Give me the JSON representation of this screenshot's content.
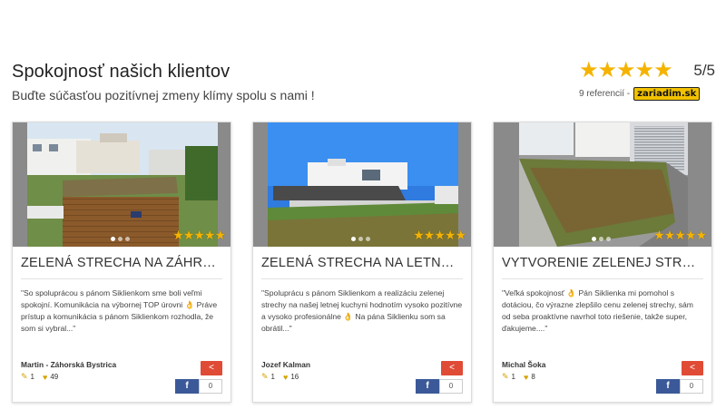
{
  "header": {
    "title": "Spokojnosť našich klientov",
    "subtitle": "Buďte súčasťou pozitívnej zmeny klímy spolu s nami !"
  },
  "rating": {
    "stars": "★★★★★",
    "score": "5/5",
    "references": "9 referencií -",
    "logo_text": "zariadim.sk"
  },
  "cards": [
    {
      "title": "ZELENÁ STRECHA NA ZÁHRAD...",
      "text": "\"So spoluprácou s pánom Siklienkom sme boli veľmi spokojní. Komunikácia na výbornej TOP úrovni 👌 Práve prístup a komunikácia s pánom Siklienkom rozhodla, že som si vybral...\"",
      "author": "Martin - Záhorská Bystrica",
      "reviews": "1",
      "likes": "49",
      "fb_label": "f",
      "fb_count": "0",
      "stars": "★★★★★"
    },
    {
      "title": "ZELENÁ STRECHA NA LETNEJ ...",
      "text": "\"Spoluprácu s pánom Siklienkom a realizáciu zelenej strechy na našej letnej kuchyni hodnotím vysoko pozitívne a vysoko profesionálne 👌 Na pána Siklienku som sa obrátil...\"",
      "author": "Jozef Kalman",
      "reviews": "1",
      "likes": "16",
      "fb_label": "f",
      "fb_count": "0",
      "stars": "★★★★★"
    },
    {
      "title": "VYTVORENIE ZELENEJ STREC...",
      "text": "\"Veľká spokojnosť 👌 Pán Siklienka mi pomohol s dotáciou, čo výrazne zlepšilo cenu zelenej strechy, sám od seba proaktívne navrhol toto riešenie, takže super, ďakujeme....\"",
      "author": "Michal Šoka",
      "reviews": "1",
      "likes": "8",
      "fb_label": "f",
      "fb_count": "0",
      "stars": "★★★★★"
    }
  ]
}
